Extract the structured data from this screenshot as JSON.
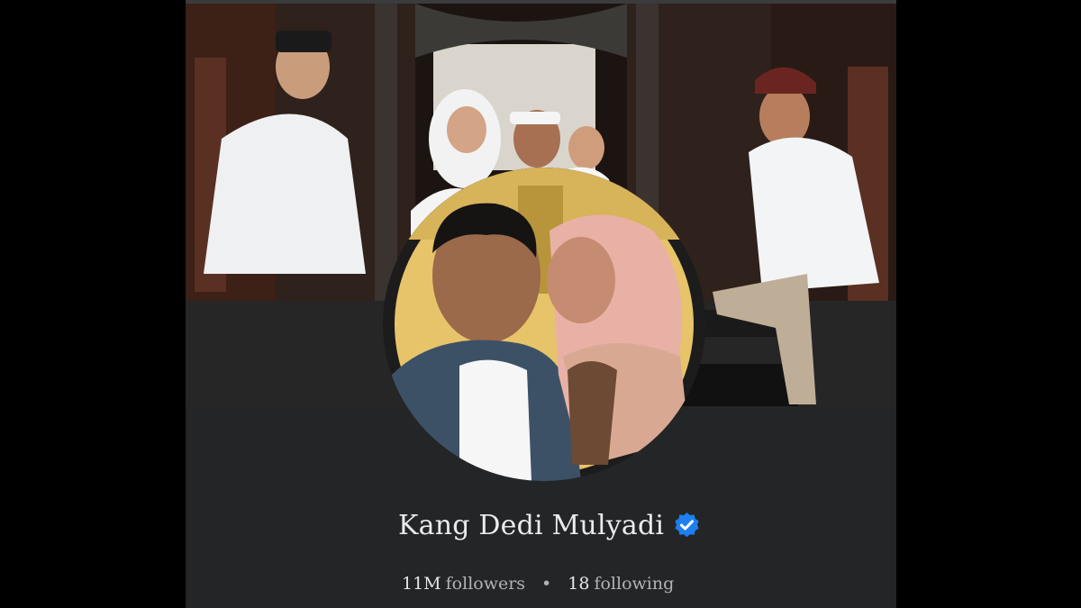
{
  "profile": {
    "name": "Kang Dedi Mulyadi",
    "verified": true,
    "verified_color": "#1d7ff0",
    "followers_count": "11M",
    "followers_label": "followers",
    "separator": "•",
    "following_count": "18",
    "following_label": "following"
  },
  "icons": {
    "verified": "verified-badge-icon"
  },
  "colors": {
    "background": "#000000",
    "card": "#242526",
    "text_primary": "#e9ecef",
    "text_secondary": "#b0b3b8"
  }
}
